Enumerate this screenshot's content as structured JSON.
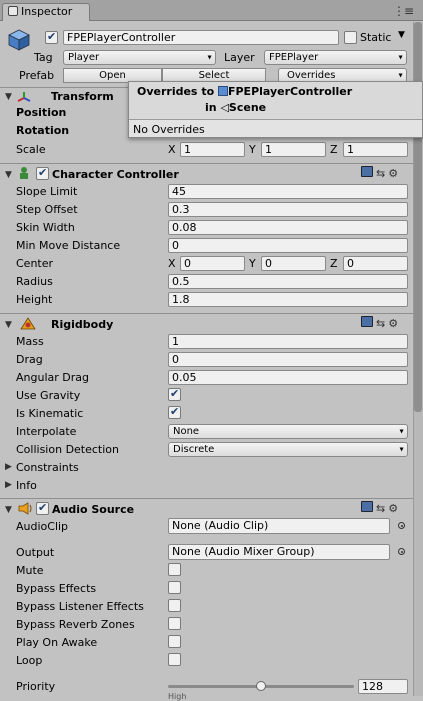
{
  "tab": {
    "label": "Inspector"
  },
  "header": {
    "object_name": "FPEPlayerController",
    "static_label": "Static",
    "tag_label": "Tag",
    "tag_value": "Player",
    "layer_label": "Layer",
    "layer_value": "FPEPlayer",
    "prefab_label": "Prefab",
    "open_label": "Open",
    "select_label": "Select",
    "overrides_label": "Overrides"
  },
  "popup": {
    "line1_prefix": "Overrides to",
    "line1_name": "FPEPlayerController",
    "line2_prefix": "in",
    "line2_name": "Scene",
    "body": "No Overrides"
  },
  "transform": {
    "title": "Transform",
    "position_label": "Position",
    "rotation_label": "Rotation",
    "scale_label": "Scale",
    "scale": {
      "x": "1",
      "y": "1",
      "z": "1"
    }
  },
  "character_controller": {
    "title": "Character Controller",
    "rows": [
      {
        "label": "Slope Limit",
        "value": "45"
      },
      {
        "label": "Step Offset",
        "value": "0.3"
      },
      {
        "label": "Skin Width",
        "value": "0.08"
      },
      {
        "label": "Min Move Distance",
        "value": "0"
      }
    ],
    "center_label": "Center",
    "center": {
      "x": "0",
      "y": "0",
      "z": "0"
    },
    "radius_label": "Radius",
    "radius": "0.5",
    "height_label": "Height",
    "height": "1.8"
  },
  "rigidbody": {
    "title": "Rigidbody",
    "mass_label": "Mass",
    "mass": "1",
    "drag_label": "Drag",
    "drag": "0",
    "angular_drag_label": "Angular Drag",
    "angular_drag": "0.05",
    "use_gravity_label": "Use Gravity",
    "use_gravity": true,
    "is_kinematic_label": "Is Kinematic",
    "is_kinematic": true,
    "interpolate_label": "Interpolate",
    "interpolate": "None",
    "collision_label": "Collision Detection",
    "collision": "Discrete",
    "constraints_label": "Constraints",
    "info_label": "Info"
  },
  "audio_source": {
    "title": "Audio Source",
    "audioclip_label": "AudioClip",
    "audioclip": "None (Audio Clip)",
    "output_label": "Output",
    "output": "None (Audio Mixer Group)",
    "checks": [
      {
        "label": "Mute",
        "checked": false
      },
      {
        "label": "Bypass Effects",
        "checked": false
      },
      {
        "label": "Bypass Listener Effects",
        "checked": false
      },
      {
        "label": "Bypass Reverb Zones",
        "checked": false
      },
      {
        "label": "Play On Awake",
        "checked": false
      },
      {
        "label": "Loop",
        "checked": false
      }
    ],
    "priority_label": "Priority",
    "priority": "128",
    "priority_fraction": 0.5,
    "high_label": "High"
  },
  "axis": {
    "x": "X",
    "y": "Y",
    "z": "Z"
  },
  "colors": {
    "background": "#c2c2c2",
    "field": "#f0f0f0",
    "accent": "#4a6fa5"
  }
}
